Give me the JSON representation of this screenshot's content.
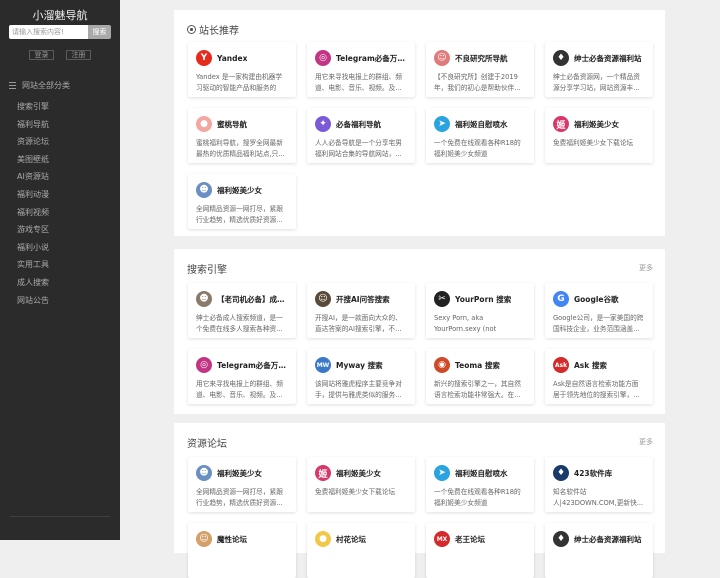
{
  "site": {
    "title": "小溜魅导航"
  },
  "search": {
    "placeholder": "请输入搜索内容!",
    "button": "搜索"
  },
  "auth": {
    "login": "登录",
    "register": "注册"
  },
  "sidebar": {
    "category_header": "网站全部分类",
    "items": [
      "搜索引擎",
      "福利导航",
      "资源论坛",
      "美图壁纸",
      "AI资源站",
      "福利动漫",
      "福利视频",
      "游戏专区",
      "福利小说",
      "实用工具",
      "成人搜索",
      "网站公告"
    ]
  },
  "sections": [
    {
      "title": "站长推荐",
      "more": "",
      "cards": [
        {
          "name": "Yandex",
          "desc": "Yandex 是一家构建由机器学习驱动的智能产品和服务的科...",
          "icon": "Y",
          "color": "#e62b1e"
        },
        {
          "name": "Telegram必备万能搜...",
          "desc": "用它来寻找电报上的群组、频道、电影、音乐、视频。及...",
          "icon": "◎",
          "color": "#c13584"
        },
        {
          "name": "不良研究所导航",
          "desc": "【不良研究所】创建于2019年，我们的初心是帮助伙伴...",
          "icon": "☺",
          "color": "#e07b7b"
        },
        {
          "name": "绅士必备资源福利站",
          "desc": "绅士必备资源网，一个精品资源分享学习站，网站资源丰...",
          "icon": "♦",
          "color": "#333333"
        },
        {
          "name": "蜜桃导航",
          "desc": "蜜桃福利导航，搜罗全网最新最热的优质精品福利站点,只...",
          "icon": "●",
          "color": "#f4a7a0"
        },
        {
          "name": "必备福利导航",
          "desc": "人人必备导航是一个分享宅男福利网站合集的导航网站，...",
          "icon": "✦",
          "color": "#7a5ad9"
        },
        {
          "name": "福利姬自慰喷水",
          "desc": "一个免费在线观看各种R18的福利姬美少女频道",
          "icon": "➤",
          "color": "#2aa3e0"
        },
        {
          "name": "福利姬美少女",
          "desc": "免费福利姬美少女下载论坛",
          "icon": "姬",
          "color": "#d9366b"
        },
        {
          "name": "福利姬美少女",
          "desc": "全网精品资源一网打尽，紧跟行业趋势，精选优质好资源...",
          "icon": "☻",
          "color": "#6b8fc2"
        }
      ]
    },
    {
      "title": "搜索引擎",
      "more": "更多",
      "cards": [
        {
          "name": "【老司机必备】成人...",
          "desc": "绅士必备成人搜索频道，是一个免费在线多人搜索各种资...",
          "icon": "☻",
          "color": "#8a7a6a"
        },
        {
          "name": "开搜AI问答搜索",
          "desc": "开搜AI，是一款面向大众的、直达答案的AI搜索引擎，不...",
          "icon": "☺",
          "color": "#5a4a3a"
        },
        {
          "name": "YourPorn 搜索",
          "desc": "Sexy Porn, aka YourPorn.sexy (not yourporn.sexy). is a pretty...",
          "icon": "✂",
          "color": "#222222"
        },
        {
          "name": "Google谷歌",
          "desc": "Google公司，是一家美国的跨国科技企业，业务范围涵盖...",
          "icon": "G",
          "color": "#4285f4"
        },
        {
          "name": "Telegram必备万能搜...",
          "desc": "用它来寻找电报上的群组、频道、电影、音乐、视频。及...",
          "icon": "◎",
          "color": "#c13584"
        },
        {
          "name": "Myway 搜索",
          "desc": "该网站将雅虎程序主要竞争对手，提供与雅虎类似的服务...",
          "icon": "MW",
          "color": "#3a78c8"
        },
        {
          "name": "Teoma 搜索",
          "desc": "新兴的搜索引擎之一，其自然语言检索功能非常强大。在...",
          "icon": "◉",
          "color": "#d04a2a"
        },
        {
          "name": "Ask 搜索",
          "desc": "Ask是自然语言检索功能方面居于领先地位的搜索引擎，...",
          "icon": "Ask",
          "color": "#d42a2a"
        }
      ]
    },
    {
      "title": "资源论坛",
      "more": "更多",
      "cards": [
        {
          "name": "福利姬美少女",
          "desc": "全网精品资源一网打尽，紧跟行业趋势，精选优质好资源...",
          "icon": "☻",
          "color": "#6b8fc2"
        },
        {
          "name": "福利姬美少女",
          "desc": "免费福利姬美少女下载论坛",
          "icon": "姬",
          "color": "#d9366b"
        },
        {
          "name": "福利姬自慰喷水",
          "desc": "一个免费在线观看各种R18的福利姬美少女频道",
          "icon": "➤",
          "color": "#2aa3e0"
        },
        {
          "name": "423软件库",
          "desc": "知名软件站 人|423DOWN.COM,更新快...",
          "icon": "♦",
          "color": "#1a3a6a"
        },
        {
          "name": "魔性论坛",
          "desc": "",
          "icon": "☺",
          "color": "#d4a06a"
        },
        {
          "name": "村花论坛",
          "desc": "",
          "icon": "●",
          "color": "#f2c84a"
        },
        {
          "name": "老王论坛",
          "desc": "",
          "icon": "MX",
          "color": "#d42a2a"
        },
        {
          "name": "绅士必备资源福利站",
          "desc": "",
          "icon": "♦",
          "color": "#333333"
        }
      ]
    }
  ]
}
